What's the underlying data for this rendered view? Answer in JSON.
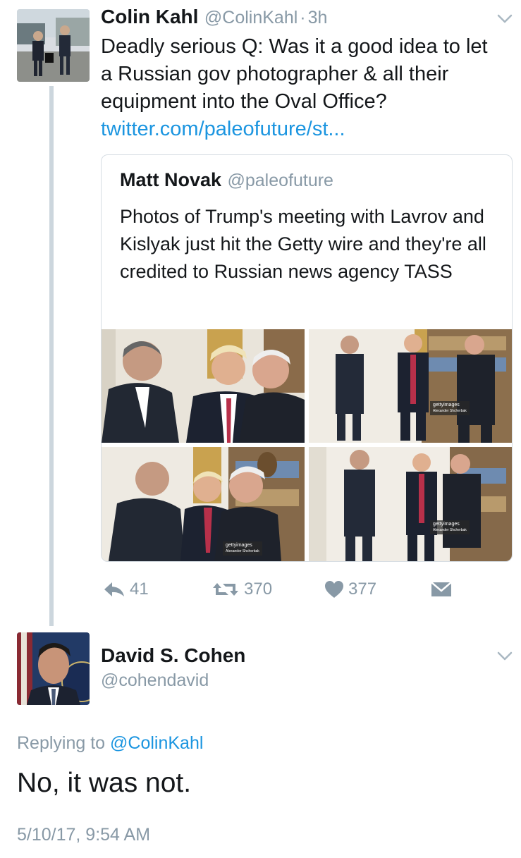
{
  "tweet": {
    "author_name": "Colin Kahl",
    "author_handle": "@ColinKahl",
    "time_sep": "·",
    "time": "3h",
    "text": "Deadly serious Q: Was it a good idea to let a Russian gov photographer & all their equipment into the Oval Office?",
    "link": "twitter.com/paleofuture/st...",
    "quoted": {
      "author_name": "Matt Novak",
      "author_handle": "@paleofuture",
      "text": "Photos of Trump's meeting with Lavrov and Kislyak just hit the Getty wire and they're all credited to Russian news agency TASS",
      "watermark": "gettyimages",
      "photographer": "Alexander Shcherbak"
    },
    "actions": {
      "reply_count": "41",
      "retweet_count": "370",
      "like_count": "377"
    }
  },
  "reply": {
    "author_name": "David S. Cohen",
    "author_handle": "@cohendavid",
    "replying_prefix": "Replying to",
    "replying_to": "@ColinKahl",
    "text": "No, it was not.",
    "timestamp": "5/10/17, 9:54 AM"
  },
  "colors": {
    "link": "#1b95e0",
    "muted": "#8899a6",
    "text": "#14171a",
    "thread_line": "#ccd6dd"
  }
}
